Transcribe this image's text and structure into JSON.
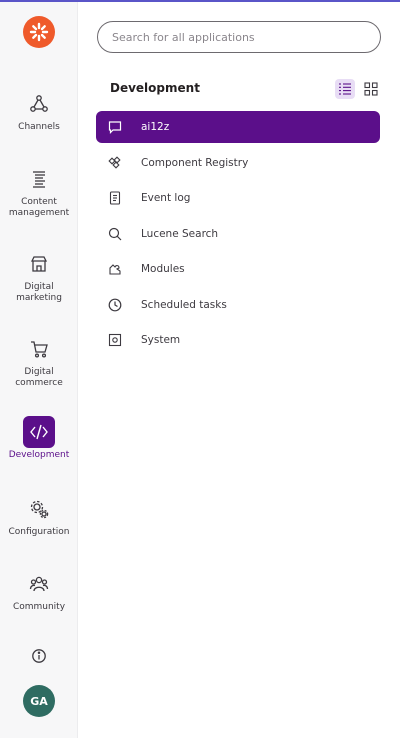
{
  "rail": {
    "items": [
      {
        "label": "Channels",
        "icon": "channels-icon"
      },
      {
        "label": "Content management",
        "icon": "content-management-icon"
      },
      {
        "label": "Digital marketing",
        "icon": "digital-marketing-icon"
      },
      {
        "label": "Digital commerce",
        "icon": "cart-icon"
      },
      {
        "label": "Development",
        "icon": "code-icon",
        "active": true
      },
      {
        "label": "Configuration",
        "icon": "gears-icon"
      },
      {
        "label": "Community",
        "icon": "community-icon"
      }
    ],
    "avatar_initials": "GA"
  },
  "search": {
    "placeholder": "Search for all applications",
    "value": ""
  },
  "section": {
    "title": "Development"
  },
  "apps": [
    {
      "label": "ai12z",
      "icon": "chat-icon",
      "active": true
    },
    {
      "label": "Component Registry",
      "icon": "component-icon"
    },
    {
      "label": "Event log",
      "icon": "document-icon"
    },
    {
      "label": "Lucene Search",
      "icon": "search-icon"
    },
    {
      "label": "Modules",
      "icon": "puzzle-icon"
    },
    {
      "label": "Scheduled tasks",
      "icon": "clock-icon"
    },
    {
      "label": "System",
      "icon": "system-icon"
    }
  ],
  "colors": {
    "accent": "#5b0f8a",
    "logo": "#ef5a2b",
    "avatar": "#2f6c62"
  }
}
